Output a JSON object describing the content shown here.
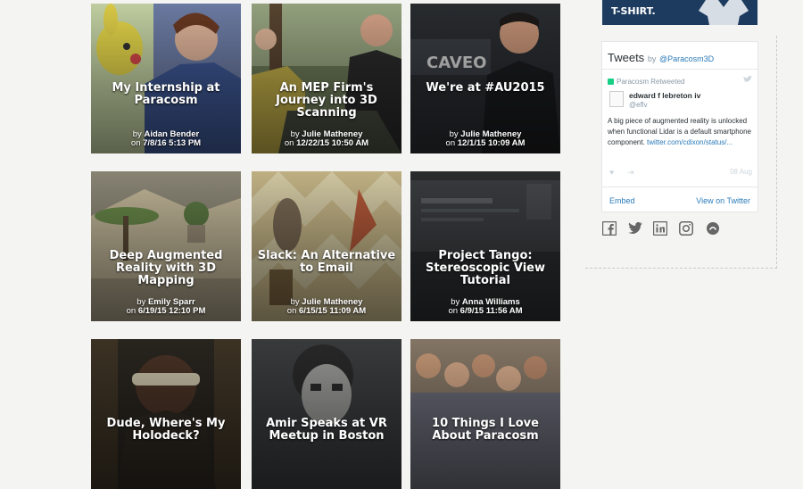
{
  "posts": [
    {
      "title": "My Internship at Paracosm",
      "by": "Aidan Bender",
      "on": "7/8/16 5:13 PM"
    },
    {
      "title": "An MEP Firm's Journey into 3D Scanning",
      "by": "Julie Matheney",
      "on": "12/22/15 10:50 AM"
    },
    {
      "title": "We're at #AU2015",
      "by": "Julie Matheney",
      "on": "12/1/15 10:09 AM"
    },
    {
      "title": "Deep Augmented Reality with 3D Mapping",
      "by": "Emily Sparr",
      "on": "6/19/15 12:10 PM"
    },
    {
      "title": "Slack: An Alternative to Email",
      "by": "Julie Matheney",
      "on": "6/15/15 11:09 AM"
    },
    {
      "title": "Project Tango: Stereoscopic View Tutorial",
      "by": "Anna Williams",
      "on": "6/9/15 11:56 AM"
    },
    {
      "title": "Dude, Where's My Holodeck?"
    },
    {
      "title": "Amir Speaks at VR Meetup in Boston"
    },
    {
      "title": "10 Things I Love About Paracosm"
    }
  ],
  "labels": {
    "by": "by",
    "on": "on"
  },
  "sidebar": {
    "banner": "T-SHIRT.",
    "tweets_title": "Tweets",
    "tweets_by": "by",
    "tweets_handle": "@Paracosm3D",
    "retweeted": "Paracosm Retweeted",
    "author_name": "edward f lebreton iv",
    "author_handle": "@eflv",
    "tweet_text": "A big piece of augmented reality is unlocked when functional Lidar is a default smartphone component.",
    "tweet_link": "twitter.com/cdixon/status/...",
    "tweet_date": "08 Aug",
    "embed": "Embed",
    "view_on_twitter": "View on Twitter",
    "social_icons": [
      "facebook-icon",
      "twitter-icon",
      "linkedin-icon",
      "instagram-icon",
      "generic-icon"
    ]
  },
  "colors": {
    "link": "#2b7bb9",
    "twitter_green": "#19cf86",
    "banner": "#1d3b5f"
  }
}
